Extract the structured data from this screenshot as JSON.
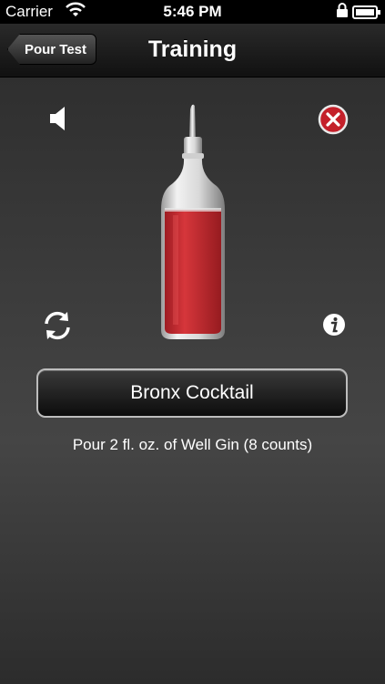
{
  "status_bar": {
    "carrier": "Carrier",
    "time": "5:46 PM"
  },
  "nav": {
    "back_label": "Pour Test",
    "title": "Training"
  },
  "training": {
    "drink_name": "Bronx Cocktail",
    "instruction": "Pour 2 fl. oz. of Well Gin (8 counts)",
    "liquid_color": "#c9282e"
  },
  "icons": {
    "speaker": "speaker-icon",
    "close": "close-icon",
    "refresh": "refresh-icon",
    "info": "info-icon"
  }
}
